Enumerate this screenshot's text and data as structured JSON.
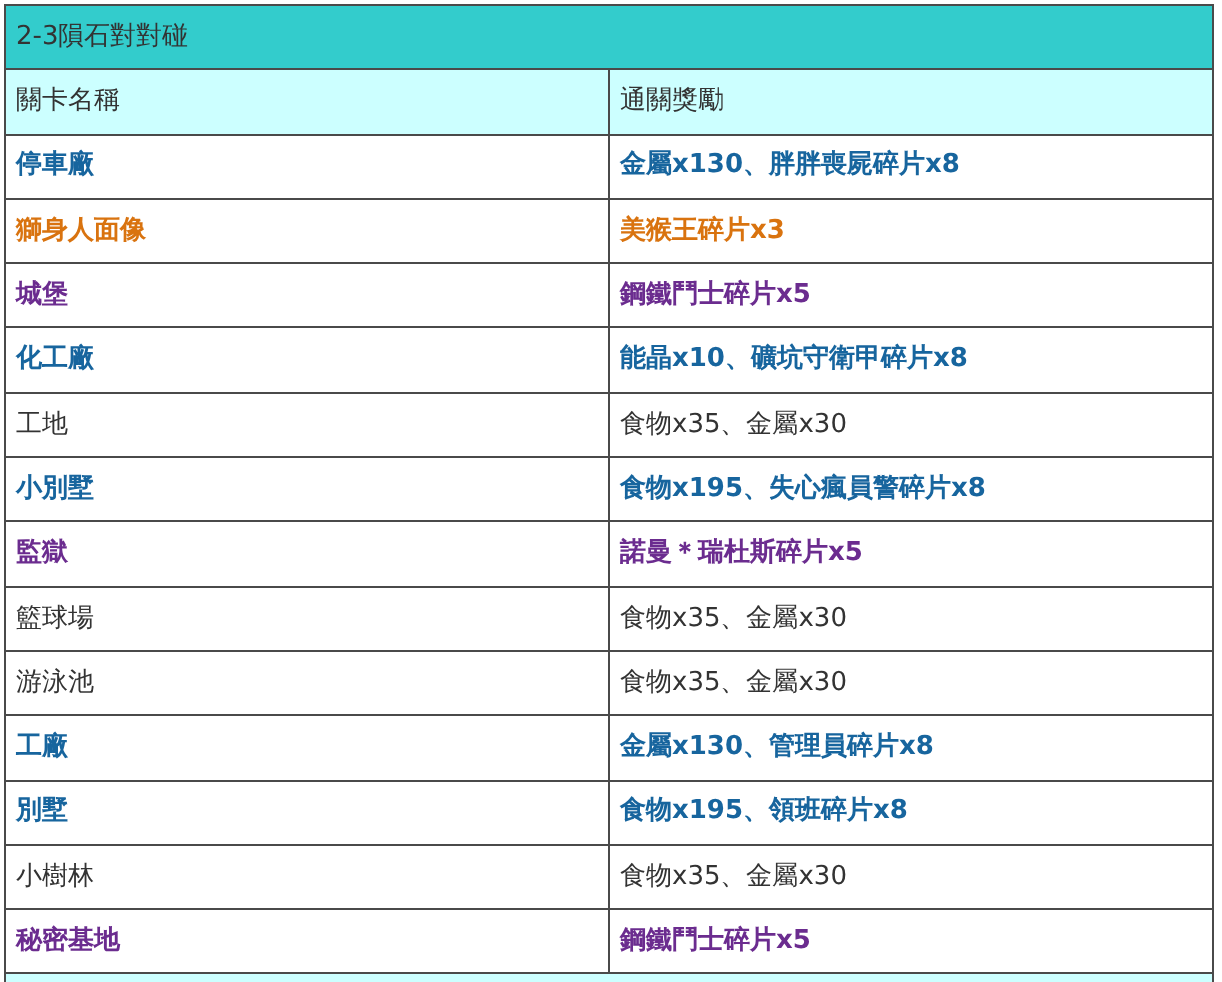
{
  "title": "2-3隕石對對碰",
  "columns": [
    "關卡名稱",
    "通關獎勵"
  ],
  "rows": [
    {
      "kind": "highlight",
      "color": "#17659e",
      "stage": "停車廠",
      "reward": "金屬x130、胖胖喪屍碎片x8"
    },
    {
      "kind": "highlight",
      "color": "#d9730f",
      "stage": "獅身人面像",
      "reward": "美猴王碎片x3"
    },
    {
      "kind": "highlight",
      "color": "#6b2c8f",
      "stage": "城堡",
      "reward": "鋼鐵鬥士碎片x5"
    },
    {
      "kind": "highlight",
      "color": "#17659e",
      "stage": "化工廠",
      "reward": "能晶x10、礦坑守衛甲碎片x8"
    },
    {
      "kind": "plain",
      "stage": "工地",
      "reward": "食物x35、金屬x30"
    },
    {
      "kind": "highlight",
      "color": "#17659e",
      "stage": "小別墅",
      "reward": "食物x195、失心瘋員警碎片x8"
    },
    {
      "kind": "highlight",
      "color": "#6b2c8f",
      "stage": "監獄",
      "reward": "諾曼＊瑞杜斯碎片x5"
    },
    {
      "kind": "plain",
      "stage": "籃球場",
      "reward": "食物x35、金屬x30"
    },
    {
      "kind": "plain",
      "stage": "游泳池",
      "reward": "食物x35、金屬x30"
    },
    {
      "kind": "highlight",
      "color": "#17659e",
      "stage": "工廠",
      "reward": "金屬x130、管理員碎片x8"
    },
    {
      "kind": "highlight",
      "color": "#17659e",
      "stage": "別墅",
      "reward": "食物x195、領班碎片x8"
    },
    {
      "kind": "plain",
      "stage": "小樹林",
      "reward": "食物x35、金屬x30"
    },
    {
      "kind": "highlight",
      "color": "#6b2c8f",
      "stage": "秘密基地",
      "reward": "鋼鐵鬥士碎片x5"
    }
  ]
}
